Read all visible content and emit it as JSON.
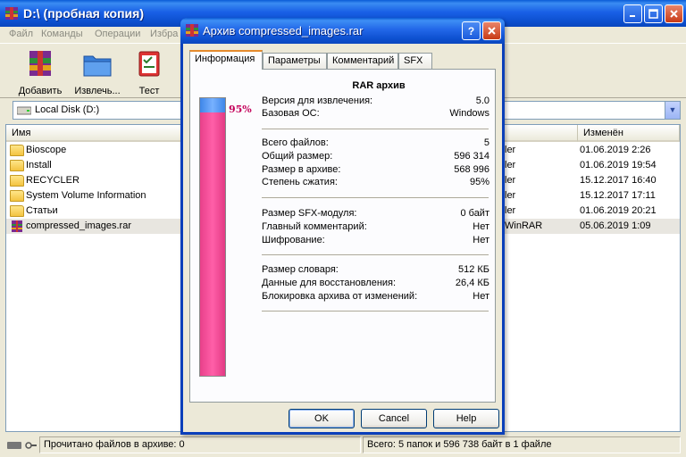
{
  "main": {
    "title": "D:\\ (пробная копия)",
    "menu": [
      "Файл",
      "Команды",
      "Операции",
      "Избра"
    ],
    "toolbar": [
      "Добавить",
      "Извлечь...",
      "Тест"
    ],
    "path": "Local Disk (D:)",
    "columns": {
      "name": "Имя",
      "modified": "Изменён"
    },
    "files": [
      {
        "name": "Bioscope",
        "type": "ler",
        "date": "01.06.2019 2:26"
      },
      {
        "name": "Install",
        "type": "ler",
        "date": "01.06.2019 19:54"
      },
      {
        "name": "RECYCLER",
        "type": "ler",
        "date": "15.12.2017 16:40"
      },
      {
        "name": "System Volume Information",
        "type": "ler",
        "date": "15.12.2017 17:11"
      },
      {
        "name": "Статьи",
        "type": "ler",
        "date": "01.06.2019 20:21"
      },
      {
        "name": "compressed_images.rar",
        "type": "WinRAR",
        "date": "05.06.2019 1:09"
      }
    ],
    "status_left": "Прочитано файлов в архиве: 0",
    "status_right": "Всего: 5 папок и 596 738 байт в 1 файле"
  },
  "dialog": {
    "title": "Архив compressed_images.rar",
    "help_btn": "?",
    "tabs": [
      "Информация",
      "Параметры",
      "Комментарий",
      "SFX"
    ],
    "ratio_label": "95%",
    "ratio_percent": 95,
    "heading": "RAR архив",
    "groups": [
      [
        {
          "k": "Версия для извлечения:",
          "v": "5.0"
        },
        {
          "k": "Базовая ОС:",
          "v": "Windows"
        }
      ],
      [
        {
          "k": "Всего файлов:",
          "v": "5"
        },
        {
          "k": "Общий размер:",
          "v": "596 314"
        },
        {
          "k": "Размер в архиве:",
          "v": "568 996"
        },
        {
          "k": "Степень сжатия:",
          "v": "95%"
        }
      ],
      [
        {
          "k": "Размер SFX-модуля:",
          "v": "0 байт"
        },
        {
          "k": "Главный комментарий:",
          "v": "Нет"
        },
        {
          "k": "Шифрование:",
          "v": "Нет"
        }
      ],
      [
        {
          "k": "Размер словаря:",
          "v": "512 КБ"
        },
        {
          "k": "Данные для восстановления:",
          "v": "26,4 КБ"
        },
        {
          "k": "Блокировка архива от изменений:",
          "v": "Нет"
        }
      ]
    ],
    "buttons": {
      "ok": "OK",
      "cancel": "Cancel",
      "help": "Help"
    }
  },
  "colors": {
    "titlebar": "#1960e6",
    "ratio_fill": "#ff5fa8",
    "ratio_top": "#3e86e8",
    "ratio_text": "#c4005a"
  }
}
